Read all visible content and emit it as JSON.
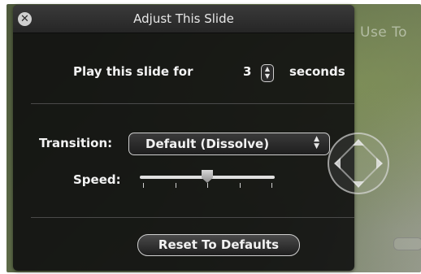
{
  "background": {
    "overlay_text": "Use To"
  },
  "hud": {
    "title": "Adjust This Slide",
    "close_glyph": "✕",
    "duration": {
      "label": "Play this slide for",
      "value": "3",
      "unit": "seconds"
    },
    "transition": {
      "label": "Transition:",
      "selected": "Default (Dissolve)"
    },
    "speed": {
      "label": "Speed:",
      "level": 0.5,
      "ticks": 5
    },
    "reset_label": "Reset To Defaults"
  },
  "icons": {
    "close": "close-icon",
    "stepper": "stepper-arrows-icon",
    "popup": "popup-arrows-icon",
    "direction": "direction-pad-icon"
  },
  "colors": {
    "panel": "#101010",
    "text": "#f2f2f2",
    "control_border": "#cfcfcf"
  }
}
